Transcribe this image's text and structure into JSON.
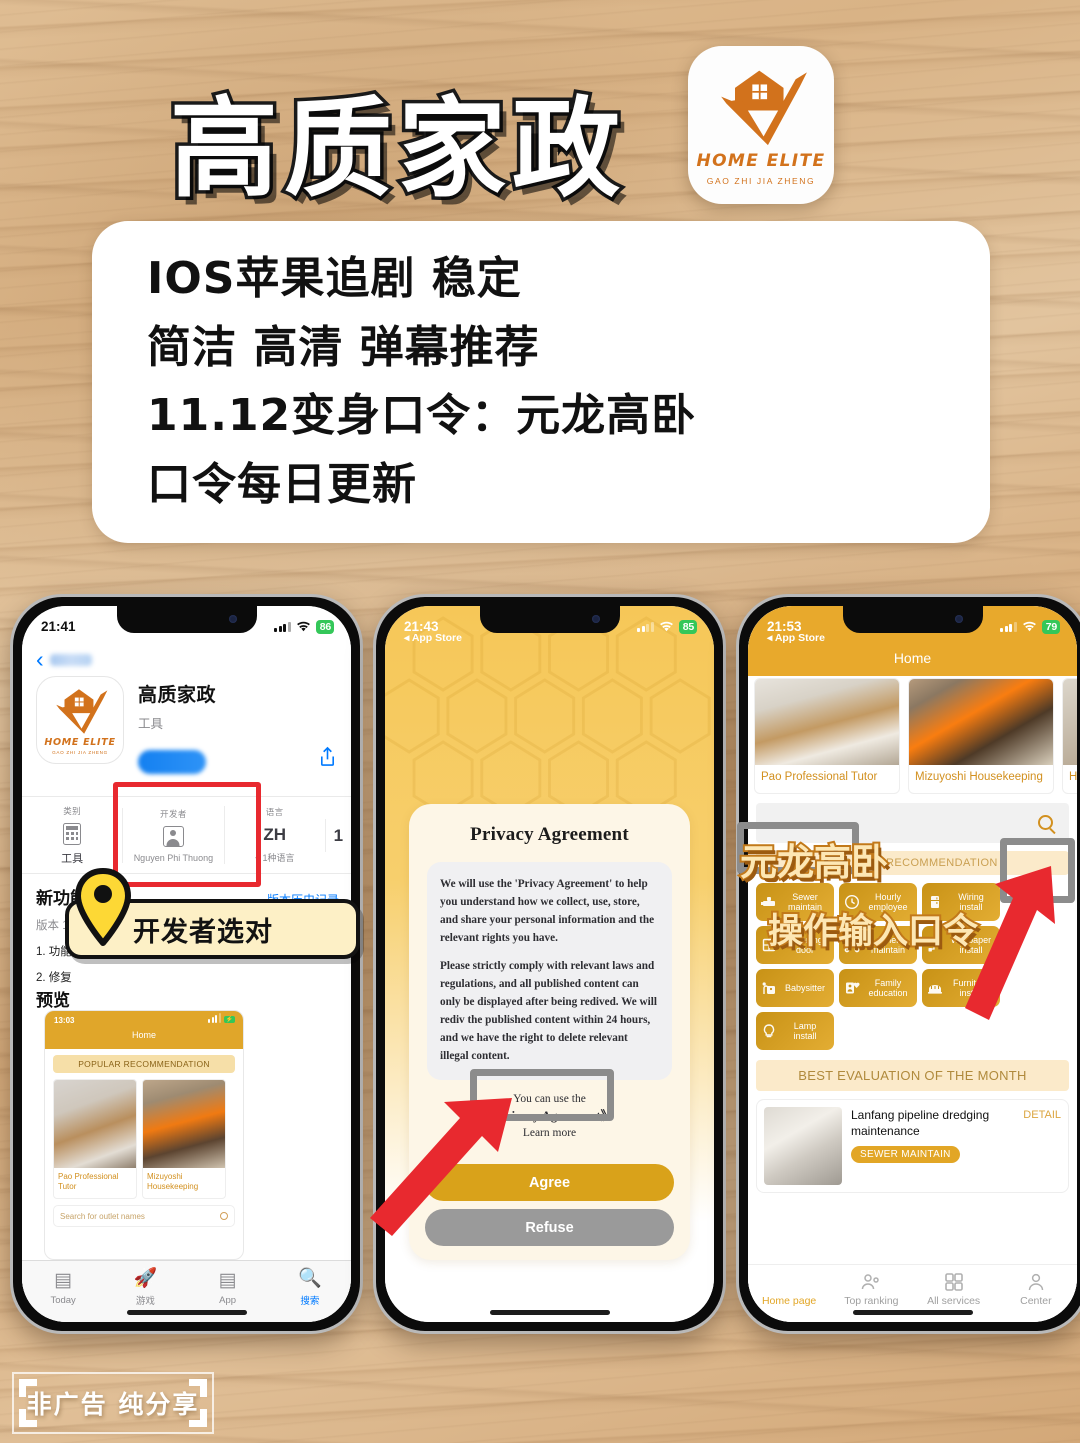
{
  "poster": {
    "title": "高质家政",
    "logo": {
      "word": "HOME ELITE",
      "sub": "GAO ZHI JIA ZHENG"
    },
    "text_card_lines": [
      "IOS苹果追剧 稳定",
      "简洁 高清 弹幕推荐",
      "11.12变身口令：元龙高卧",
      "口令每日更新"
    ],
    "bottom_badge": "非广告 纯分享",
    "accent_color": "#d2721c",
    "wood_color": "#dfbd93"
  },
  "phone1": {
    "status": {
      "time": "21:41",
      "battery": "86"
    },
    "app": {
      "name": "高质家政",
      "category": "工具",
      "icon_word": "HOME ELITE",
      "icon_sub": "GAO ZHI JIA ZHENG"
    },
    "info_cells": [
      {
        "header": "类别",
        "value": "工具"
      },
      {
        "header": "开发者",
        "value": "Nguyen Phi Thuong"
      },
      {
        "header": "语言",
        "big": "ZH",
        "value": "+ 1种语言"
      },
      {
        "header": "",
        "big": "1",
        "value": ""
      }
    ],
    "whats_new": {
      "title": "新功能",
      "link": "版本历史记录",
      "version": "版本 1",
      "item1": "1. 功能",
      "item2": "2. 修复"
    },
    "preview_header": "预览",
    "callout": "开发者选对",
    "mini": {
      "time": "13:03",
      "title": "Home",
      "popular": "POPULAR RECOMMENDATION",
      "cards": [
        {
          "caption": "Pao Professional Tutor"
        },
        {
          "caption": "Mizuyoshi Housekeeping"
        }
      ],
      "search_placeholder": "Search for outlet names"
    },
    "tabs": [
      {
        "label": "Today",
        "icon": "today-icon"
      },
      {
        "label": "游戏",
        "icon": "rocket-icon"
      },
      {
        "label": "App",
        "icon": "stack-icon"
      },
      {
        "label": "搜索",
        "icon": "search-icon"
      }
    ]
  },
  "phone2": {
    "status": {
      "time": "21:43",
      "battery": "85",
      "back": "App Store"
    },
    "title": "Privacy Agreement",
    "paragraphs": [
      "We will use the 'Privacy Agreement' to help you understand how we collect, use, store, and share your personal information and the relevant rights you have.",
      "Please strictly comply with relevant laws and regulations, and all published content can only be displayed after being redived. We will rediv the published content within 24 hours, and we have the right to delete relevant illegal content."
    ],
    "use_line": "You can use the",
    "use_bold": "《Privacy Agreement》",
    "learn_more": "Learn more",
    "agree": "Agree",
    "refuse": "Refuse"
  },
  "phone3": {
    "status": {
      "time": "21:53",
      "battery": "79",
      "back": "App Store"
    },
    "nav_title": "Home",
    "top_cards": [
      {
        "caption": "Pao Professional Tutor"
      },
      {
        "caption": "Mizuyoshi Housekeeping"
      },
      {
        "caption": "H H"
      }
    ],
    "banner": "POPULAR RECOMMENDATION",
    "overlay_code": "元龙高卧",
    "overlay_hint": "操作输入口令",
    "services": [
      {
        "label": "Sewer maintain",
        "icon": "pipe-icon"
      },
      {
        "label": "Hourly employee",
        "icon": "clock-icon"
      },
      {
        "label": "Wiring install",
        "icon": "fridge-icon"
      },
      {
        "label": "Cleaning door",
        "icon": "window-icon"
      },
      {
        "label": "Other maintain",
        "icon": "tools-icon"
      },
      {
        "label": "Wallpaper install",
        "icon": "roller-icon"
      },
      {
        "label": "Babysitter",
        "icon": "baby-icon"
      },
      {
        "label": "Family education",
        "icon": "heart-doc-icon"
      },
      {
        "label": "Furniture install",
        "icon": "sofa-icon"
      },
      {
        "label": "Lamp install",
        "icon": "bulb-icon"
      }
    ],
    "best_header": "BEST EVALUATION OF THE MONTH",
    "evaluation": {
      "title": "Lanfang pipeline dredging maintenance",
      "tag": "SEWER MAINTAIN",
      "detail": "DETAIL"
    },
    "tabs": [
      {
        "label": "Home page",
        "icon": "home-icon"
      },
      {
        "label": "Top ranking",
        "icon": "ranking-icon"
      },
      {
        "label": "All services",
        "icon": "grid-icon"
      },
      {
        "label": "Center",
        "icon": "person-icon"
      }
    ]
  }
}
